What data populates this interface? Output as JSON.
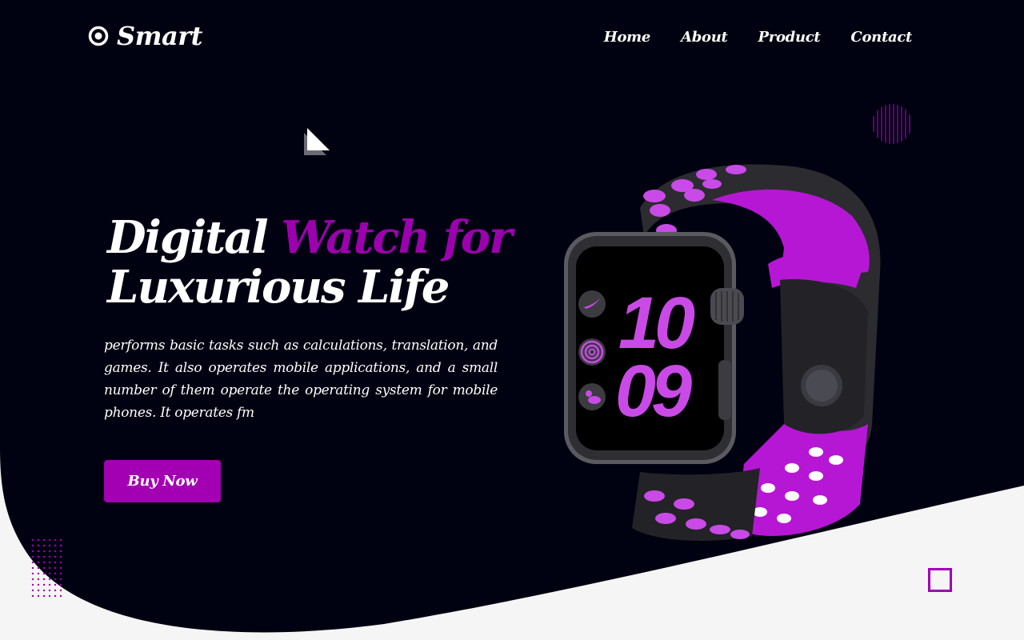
{
  "brand": {
    "name": "Smart",
    "icon": "target-icon"
  },
  "nav": {
    "items": [
      "Home",
      "About",
      "Product",
      "Contact"
    ]
  },
  "hero": {
    "title_line1_plain": "Digital",
    "title_line1_accent": "Watch for",
    "title_line2": "Luxurious Life",
    "description": "performs basic tasks such as calculations, translation, and games. It also operates mobile applications, and a small number of them operate the operating system for mobile phones. It operates fm",
    "cta_label": "Buy Now"
  },
  "watch_display": {
    "hour": "10",
    "minute": "09"
  },
  "colors": {
    "background_dark": "#010211",
    "accent": "#a300b3",
    "page_light": "#f5f5f5"
  }
}
